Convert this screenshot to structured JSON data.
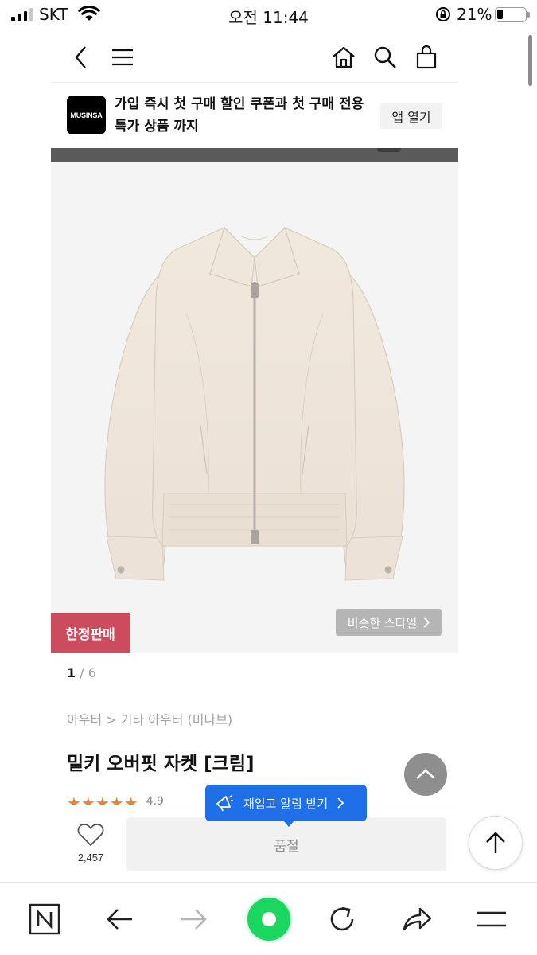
{
  "status_bar": {
    "carrier": "SKT",
    "time": "오전 11:44",
    "battery_percent": "21%",
    "battery_level": 0.21
  },
  "header": {
    "icons": [
      "back-icon",
      "menu-icon",
      "home-icon",
      "search-icon",
      "cart-icon"
    ]
  },
  "app_banner": {
    "logo_text": "MUSINSA",
    "message_line1": "가입 즉시 첫 구매 할인 쿠폰과 첫 구매 전용",
    "message_line2": "특가 상품 까지",
    "open_app_label": "앱 열기"
  },
  "product_image": {
    "badge": "한정판매",
    "similar_style_label": "비슷한 스타일",
    "current_page": "1",
    "total_pages": "6"
  },
  "product": {
    "breadcrumb": "아우터 > 기타 아우터 (미나브)",
    "name": "밀키 오버핏 자켓 [크림]",
    "rating": "4.9",
    "star_count": 5
  },
  "restock_tooltip": {
    "label": "재입고 알림 받기"
  },
  "purchase_bar": {
    "wishlist_count": "2,457",
    "sold_out_label": "품절"
  },
  "browser_toolbar": {
    "icons": [
      "naver-n-icon",
      "back-arrow-icon",
      "forward-arrow-icon",
      "green-dot-icon",
      "refresh-icon",
      "share-icon",
      "menu-icon"
    ]
  },
  "colors": {
    "badge_red": "#cc4b5c",
    "tooltip_blue": "#1f6fe8",
    "star_orange": "#e8833a",
    "green_button": "#1bd760"
  }
}
